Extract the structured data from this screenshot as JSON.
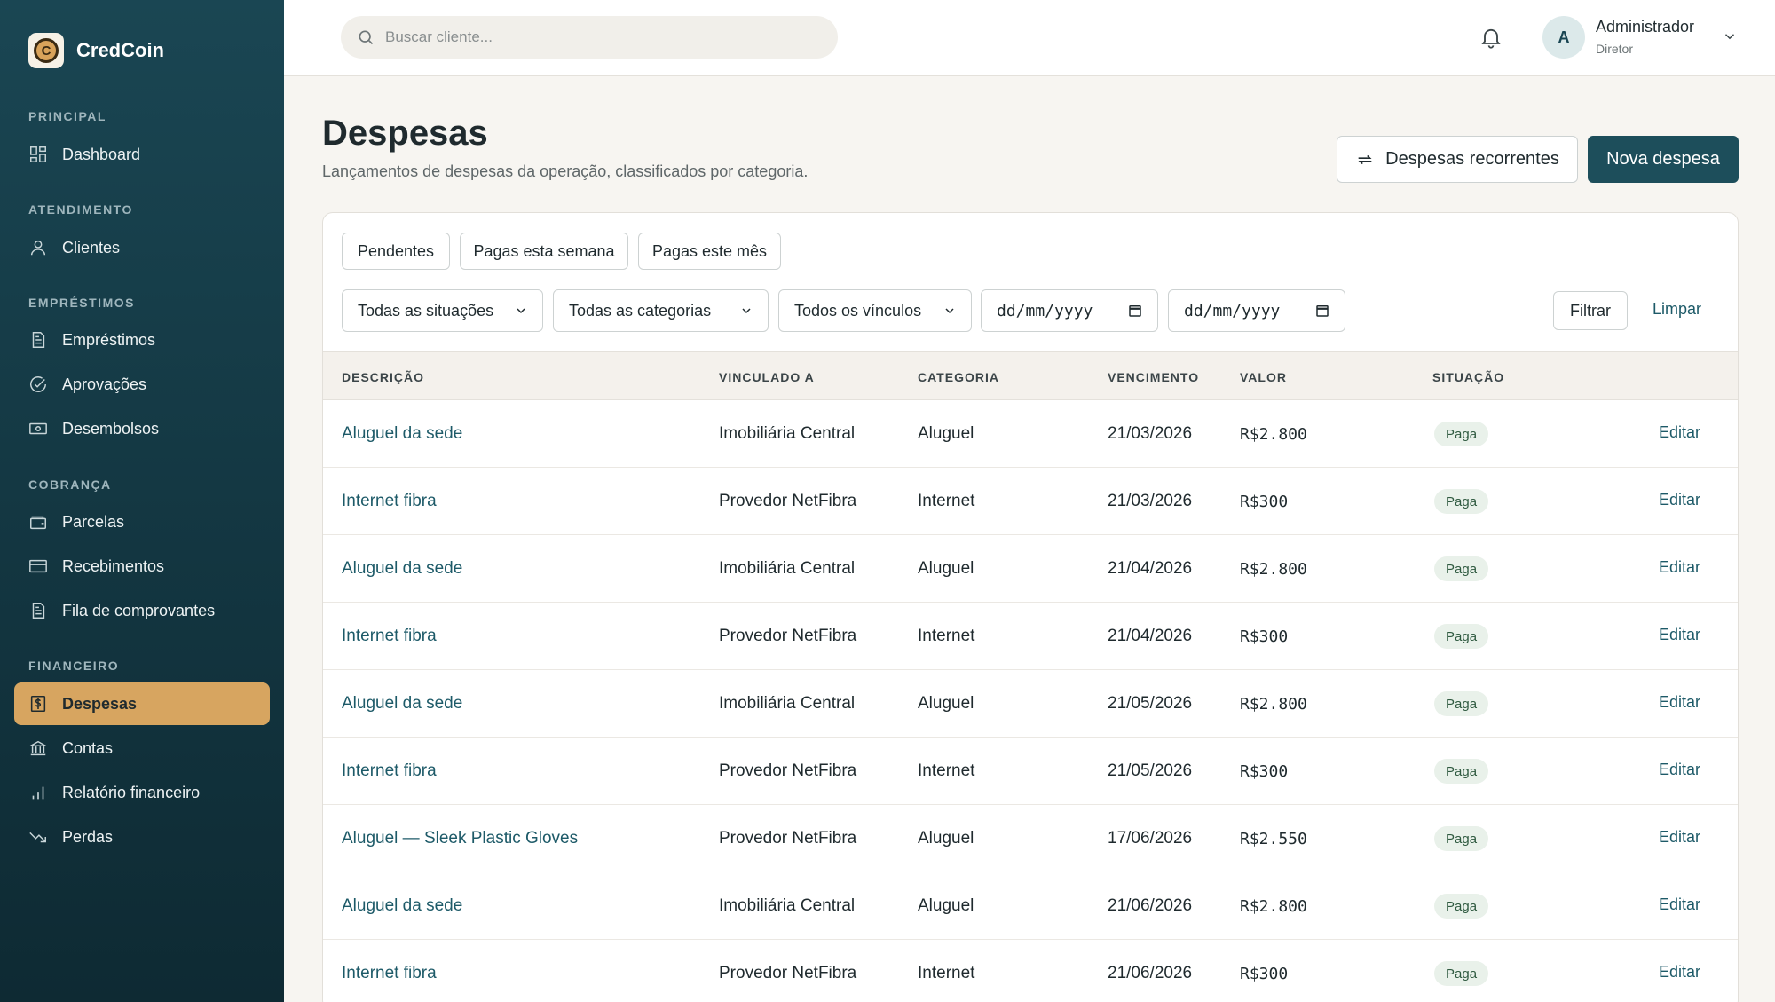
{
  "brand": {
    "name": "CredCoin",
    "logo_letter": "C"
  },
  "sidebar": {
    "sections": [
      {
        "label": "PRINCIPAL",
        "items": [
          {
            "label": "Dashboard",
            "icon": "dashboard-icon"
          }
        ]
      },
      {
        "label": "ATENDIMENTO",
        "items": [
          {
            "label": "Clientes",
            "icon": "user-icon"
          }
        ]
      },
      {
        "label": "EMPRÉSTIMOS",
        "items": [
          {
            "label": "Empréstimos",
            "icon": "document-icon"
          },
          {
            "label": "Aprovações",
            "icon": "check-circle-icon"
          },
          {
            "label": "Desembolsos",
            "icon": "cash-icon"
          }
        ]
      },
      {
        "label": "COBRANÇA",
        "items": [
          {
            "label": "Parcelas",
            "icon": "wallet-icon"
          },
          {
            "label": "Recebimentos",
            "icon": "card-icon"
          },
          {
            "label": "Fila de comprovantes",
            "icon": "document-icon"
          }
        ]
      },
      {
        "label": "FINANCEIRO",
        "items": [
          {
            "label": "Despesas",
            "icon": "dollar-doc-icon",
            "active": true
          },
          {
            "label": "Contas",
            "icon": "bank-icon"
          },
          {
            "label": "Relatório financeiro",
            "icon": "bar-chart-icon"
          },
          {
            "label": "Perdas",
            "icon": "trending-down-icon"
          }
        ]
      }
    ]
  },
  "topbar": {
    "search_placeholder": "Buscar cliente...",
    "user": {
      "initial": "A",
      "name": "Administrador",
      "role": "Diretor"
    }
  },
  "header": {
    "title": "Despesas",
    "subtitle": "Lançamentos de despesas da operação, classificados por categoria.",
    "recurring_button": "Despesas recorrentes",
    "new_button": "Nova despesa"
  },
  "quick_filters": [
    "Pendentes",
    "Pagas esta semana",
    "Pagas este mês"
  ],
  "filters": {
    "situacao": "Todas as situações",
    "categoria": "Todas as categorias",
    "vinculo": "Todos os vínculos",
    "date_from": "dd/mm/yyyy",
    "date_to": "dd/mm/yyyy",
    "filter_button": "Filtrar",
    "clear_button": "Limpar"
  },
  "table": {
    "columns": [
      "DESCRIÇÃO",
      "VINCULADO A",
      "CATEGORIA",
      "VENCIMENTO",
      "VALOR",
      "SITUAÇÃO"
    ],
    "edit_label": "Editar",
    "rows": [
      {
        "descricao": "Aluguel da sede",
        "vinculado": "Imobiliária Central",
        "categoria": "Aluguel",
        "vencimento": "21/03/2026",
        "valor": "R$2.800",
        "situacao": "Paga"
      },
      {
        "descricao": "Internet fibra",
        "vinculado": "Provedor NetFibra",
        "categoria": "Internet",
        "vencimento": "21/03/2026",
        "valor": "R$300",
        "situacao": "Paga"
      },
      {
        "descricao": "Aluguel da sede",
        "vinculado": "Imobiliária Central",
        "categoria": "Aluguel",
        "vencimento": "21/04/2026",
        "valor": "R$2.800",
        "situacao": "Paga"
      },
      {
        "descricao": "Internet fibra",
        "vinculado": "Provedor NetFibra",
        "categoria": "Internet",
        "vencimento": "21/04/2026",
        "valor": "R$300",
        "situacao": "Paga"
      },
      {
        "descricao": "Aluguel da sede",
        "vinculado": "Imobiliária Central",
        "categoria": "Aluguel",
        "vencimento": "21/05/2026",
        "valor": "R$2.800",
        "situacao": "Paga"
      },
      {
        "descricao": "Internet fibra",
        "vinculado": "Provedor NetFibra",
        "categoria": "Internet",
        "vencimento": "21/05/2026",
        "valor": "R$300",
        "situacao": "Paga"
      },
      {
        "descricao": "Aluguel — Sleek Plastic Gloves",
        "vinculado": "Provedor NetFibra",
        "categoria": "Aluguel",
        "vencimento": "17/06/2026",
        "valor": "R$2.550",
        "situacao": "Paga"
      },
      {
        "descricao": "Aluguel da sede",
        "vinculado": "Imobiliária Central",
        "categoria": "Aluguel",
        "vencimento": "21/06/2026",
        "valor": "R$2.800",
        "situacao": "Paga"
      },
      {
        "descricao": "Internet fibra",
        "vinculado": "Provedor NetFibra",
        "categoria": "Internet",
        "vencimento": "21/06/2026",
        "valor": "R$300",
        "situacao": "Paga"
      }
    ]
  },
  "colors": {
    "sidebar": "#1a4653",
    "accent": "#d7a560",
    "primary": "#1d4e5b",
    "link": "#1d5a68",
    "badge_bg": "#e9f1ea"
  }
}
